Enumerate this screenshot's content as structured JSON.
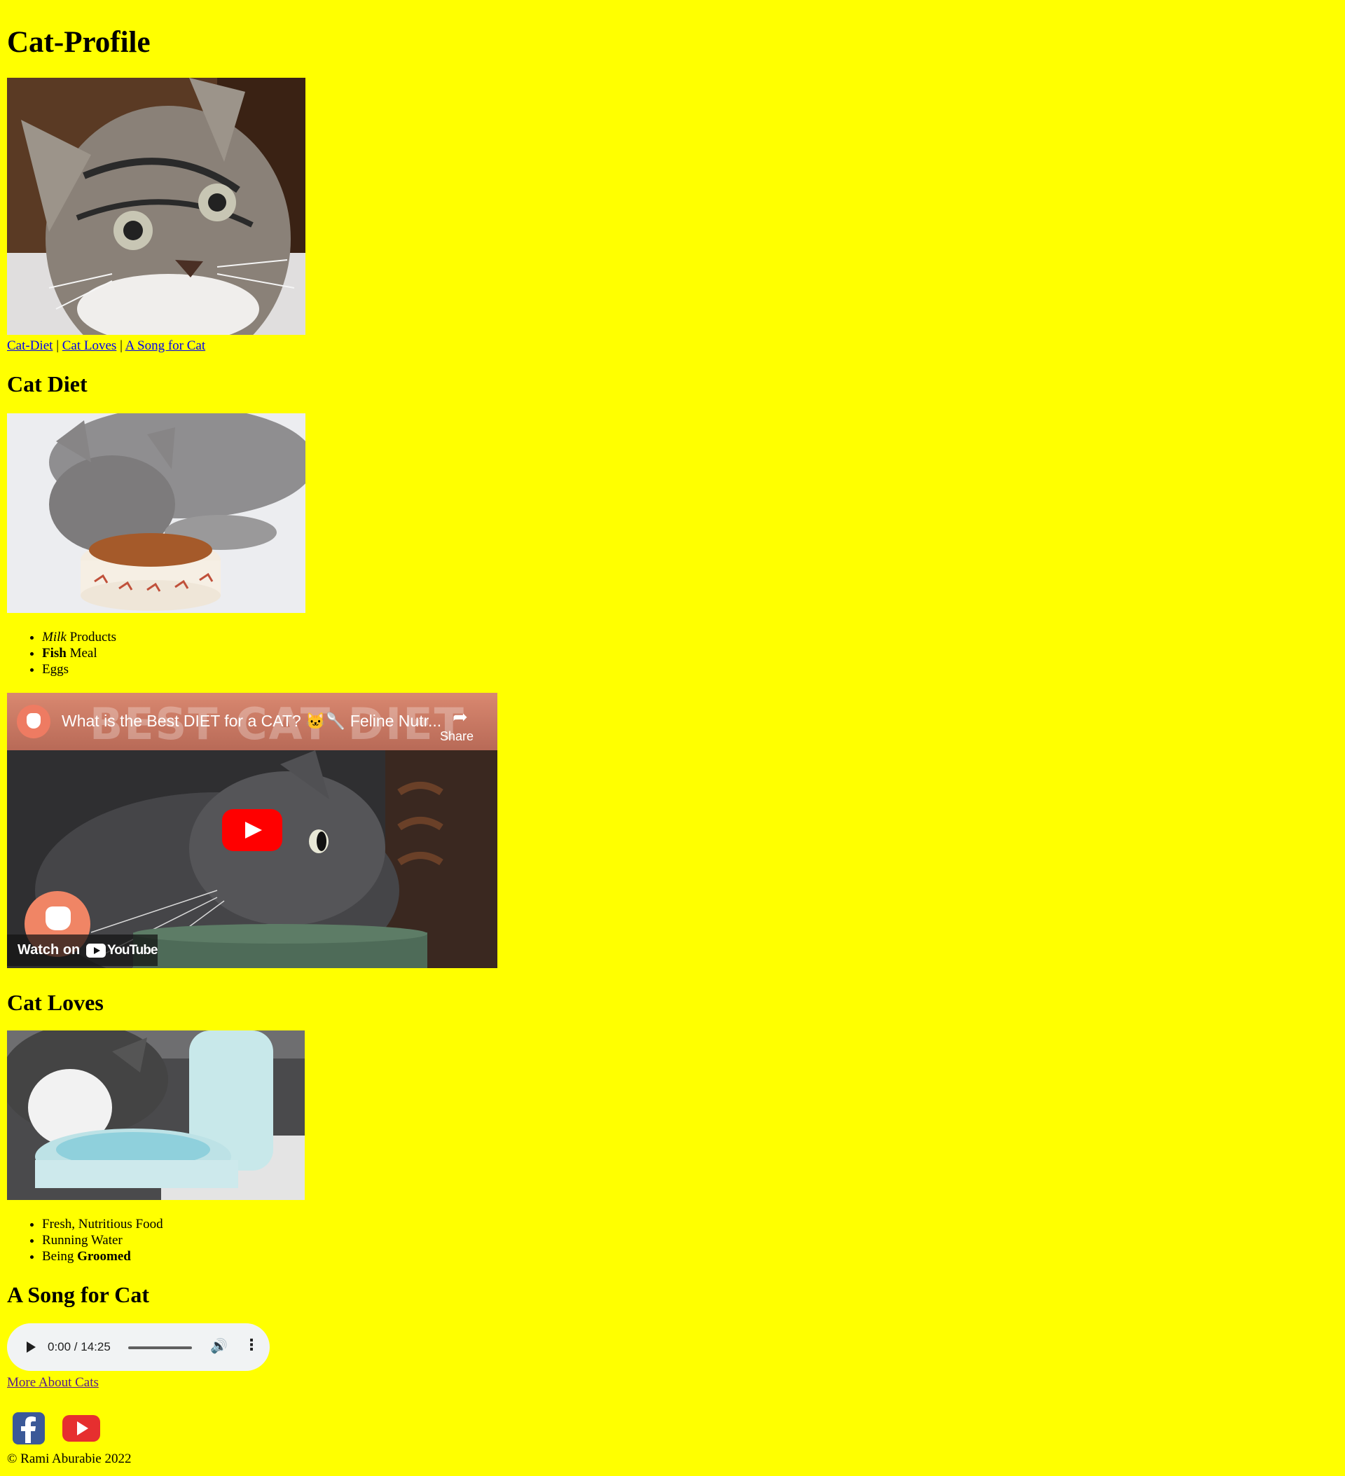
{
  "page": {
    "title": "Cat-Profile",
    "background_color": "#ffff00"
  },
  "nav": {
    "links": [
      "Cat-Diet",
      "Cat Loves",
      "A Song for Cat"
    ],
    "separator": "|"
  },
  "diet": {
    "heading": "Cat Diet",
    "items": [
      {
        "emphasis": "Milk",
        "rest": " Products"
      },
      {
        "emphasis": "Fish",
        "rest": " Meal"
      },
      {
        "emphasis": "",
        "rest": "Eggs"
      }
    ]
  },
  "video": {
    "title": "What is the Best DIET for a CAT? 🐱🥄 Feline Nutr...",
    "background_text": "BEST CAT DIET",
    "share_label": "Share",
    "watch_label": "Watch on",
    "platform_label": "YouTube",
    "play_color": "#ff0000"
  },
  "loves": {
    "heading": "Cat Loves",
    "items": [
      {
        "pre": "Fresh, Nutritious Food",
        "strong": ""
      },
      {
        "pre": "Running Water",
        "strong": ""
      },
      {
        "pre": "Being ",
        "strong": "Groomed"
      }
    ]
  },
  "song": {
    "heading": "A Song for Cat",
    "time": "0:00 / 14:25"
  },
  "more_link": "More About Cats",
  "social": [
    {
      "icon": "facebook-icon",
      "color": "#3b5998"
    },
    {
      "icon": "youtube-icon",
      "color": "#ff0000"
    }
  ],
  "footer": "© Rami Aburabie 2022"
}
